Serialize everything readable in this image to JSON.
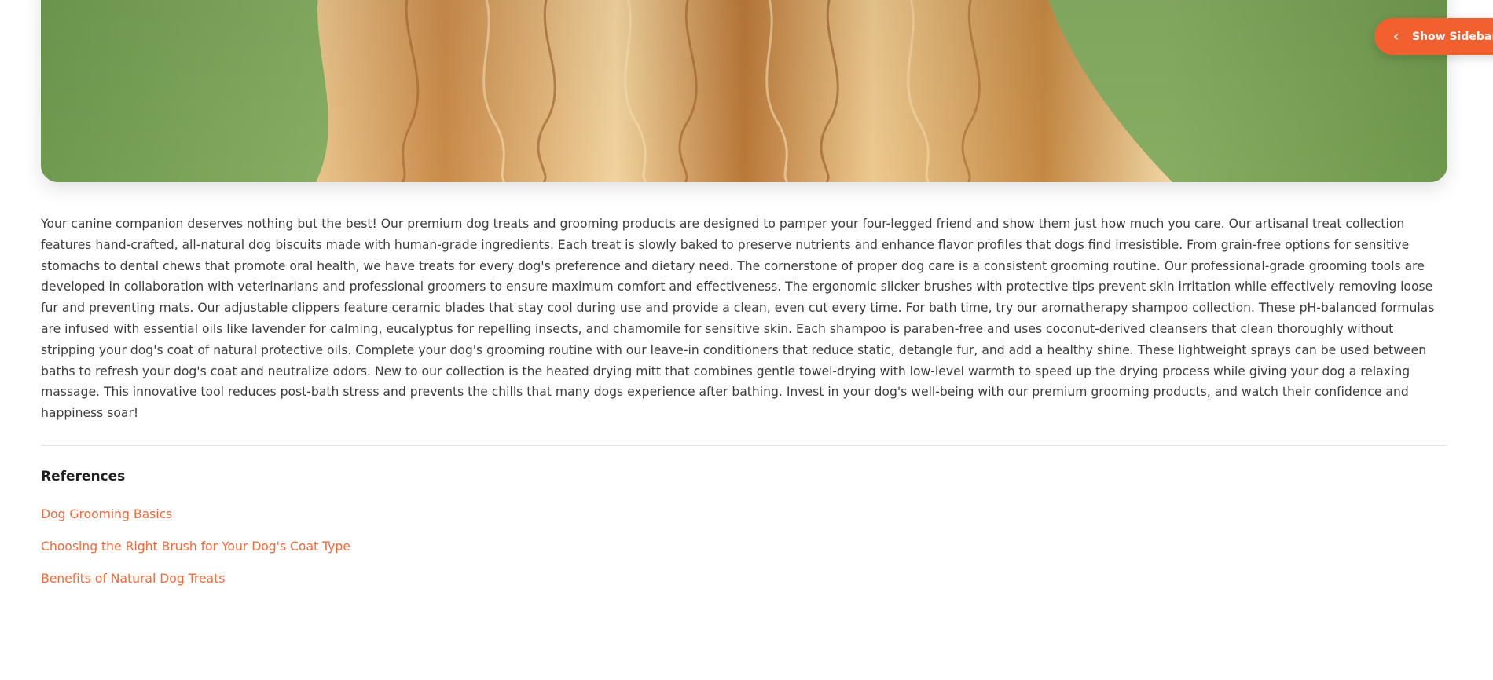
{
  "sidebar_toggle": {
    "label": "Show Sidebar",
    "icon": "chevron-left-icon"
  },
  "hero": {
    "image": "golden-dog-fur-photo"
  },
  "article": {
    "body": "Your canine companion deserves nothing but the best! Our premium dog treats and grooming products are designed to pamper your four-legged friend and show them just how much you care. Our artisanal treat collection features hand-crafted, all-natural dog biscuits made with human-grade ingredients. Each treat is slowly baked to preserve nutrients and enhance flavor profiles that dogs find irresistible. From grain-free options for sensitive stomachs to dental chews that promote oral health, we have treats for every dog's preference and dietary need. The cornerstone of proper dog care is a consistent grooming routine. Our professional-grade grooming tools are developed in collaboration with veterinarians and professional groomers to ensure maximum comfort and effectiveness. The ergonomic slicker brushes with protective tips prevent skin irritation while effectively removing loose fur and preventing mats. Our adjustable clippers feature ceramic blades that stay cool during use and provide a clean, even cut every time. For bath time, try our aromatherapy shampoo collection. These pH-balanced formulas are infused with essential oils like lavender for calming, eucalyptus for repelling insects, and chamomile for sensitive skin. Each shampoo is paraben-free and uses coconut-derived cleansers that clean thoroughly without stripping your dog's coat of natural protective oils. Complete your dog's grooming routine with our leave-in conditioners that reduce static, detangle fur, and add a healthy shine. These lightweight sprays can be used between baths to refresh your dog's coat and neutralize odors. New to our collection is the heated drying mitt that combines gentle towel-drying with low-level warmth to speed up the drying process while giving your dog a relaxing massage. This innovative tool reduces post-bath stress and prevents the chills that many dogs experience after bathing. Invest in your dog's well-being with our premium grooming products, and watch their confidence and happiness soar!"
  },
  "references": {
    "heading": "References",
    "links": [
      {
        "label": "Dog Grooming Basics"
      },
      {
        "label": "Choosing the Right Brush for Your Dog's Coat Type"
      },
      {
        "label": "Benefits of Natural Dog Treats"
      }
    ]
  },
  "colors": {
    "accent": "#f2602f",
    "link": "#ef6a3a",
    "text": "#3d3d3d",
    "heading": "#1e1e1e",
    "divider": "#e4e4e4"
  }
}
